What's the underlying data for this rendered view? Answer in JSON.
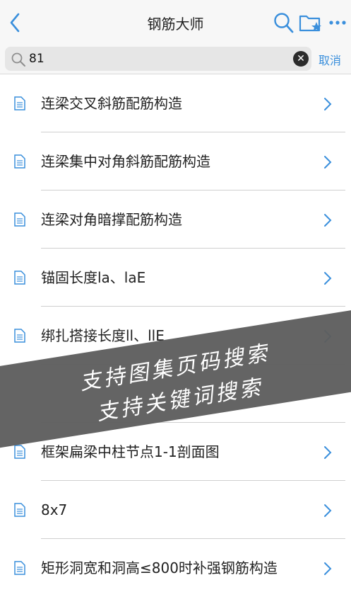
{
  "header": {
    "title": "钢筋大师",
    "back_icon": "chevron-left-icon",
    "search_icon": "search-icon",
    "favorites_icon": "folder-star-icon",
    "more_icon": "more-icon"
  },
  "search": {
    "value": "81",
    "cancel_label": "取消"
  },
  "list": [
    {
      "label": "连梁交叉斜筋配筋构造"
    },
    {
      "label": "连梁集中对角斜筋配筋构造"
    },
    {
      "label": "连梁对角暗撑配筋构造"
    },
    {
      "label": "锚固长度la、laE"
    },
    {
      "label": "绑扎搭接长度ll、llE"
    },
    {
      "label": ""
    },
    {
      "label": "框架扁梁中柱节点1-1剖面图"
    },
    {
      "label": "8x7"
    },
    {
      "label": "矩形洞宽和洞高≤800时补强钢筋构造"
    }
  ],
  "banner": {
    "line1": "支持图集页码搜索",
    "line2": "支持关键词搜索"
  },
  "colors": {
    "accent": "#3a8fdc",
    "banner": "#5e5e5e"
  }
}
